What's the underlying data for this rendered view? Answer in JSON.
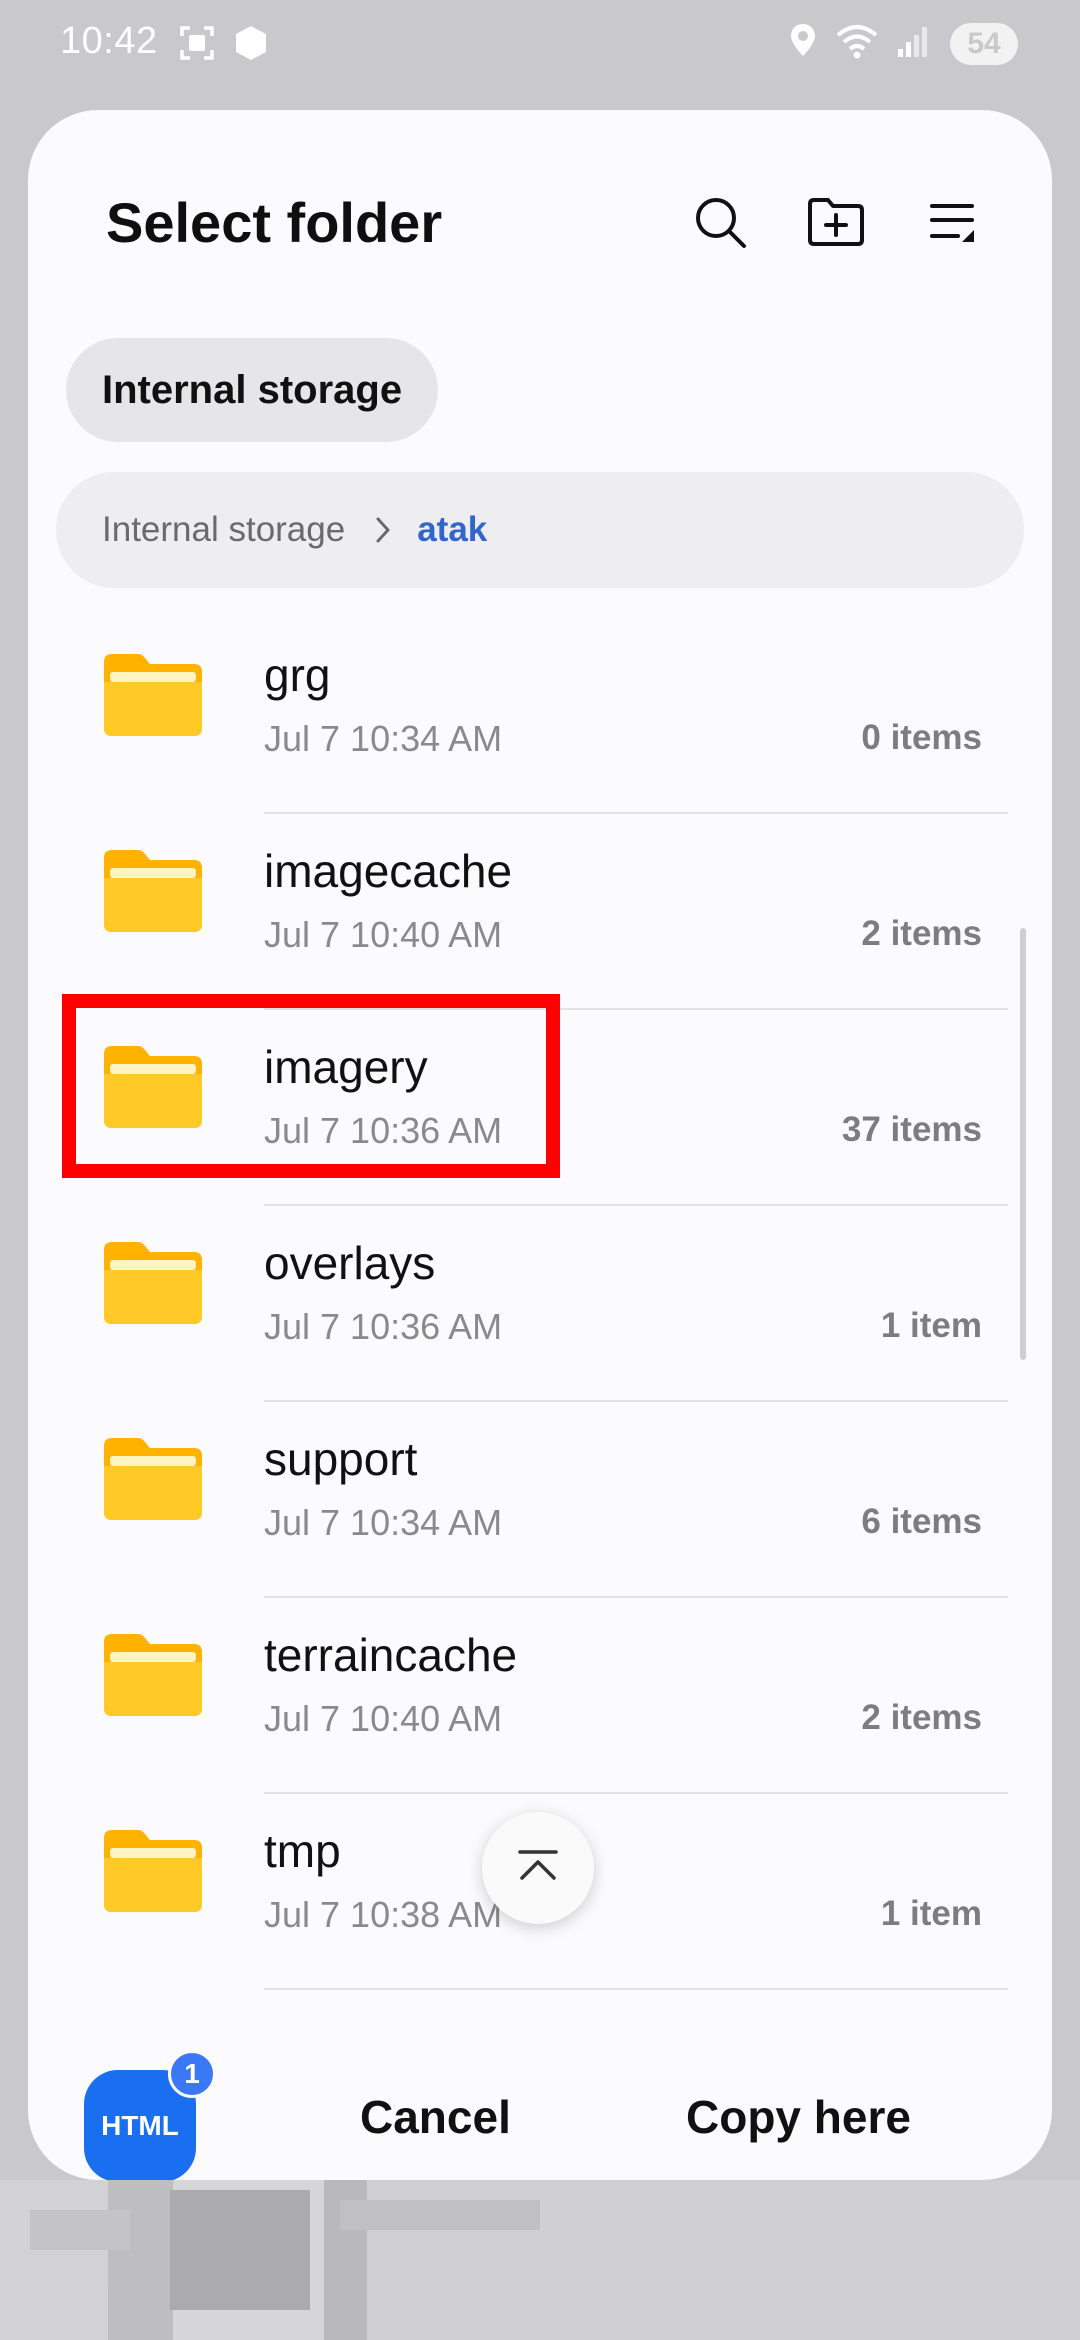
{
  "status_bar": {
    "time": "10:42",
    "battery": "54"
  },
  "header": {
    "title": "Select folder",
    "actions": [
      "search-icon",
      "new-folder-icon",
      "sort-icon"
    ]
  },
  "storage_chip": {
    "label": "Internal storage"
  },
  "breadcrumb": {
    "root": "Internal storage",
    "current": "atak"
  },
  "folders": [
    {
      "name": "grg",
      "date": "Jul 7 10:34 AM",
      "count": "0 items"
    },
    {
      "name": "imagecache",
      "date": "Jul 7 10:40 AM",
      "count": "2 items"
    },
    {
      "name": "imagery",
      "date": "Jul 7 10:36 AM",
      "count": "37 items"
    },
    {
      "name": "overlays",
      "date": "Jul 7 10:36 AM",
      "count": "1 item"
    },
    {
      "name": "support",
      "date": "Jul 7 10:34 AM",
      "count": "6 items"
    },
    {
      "name": "terraincache",
      "date": "Jul 7 10:40 AM",
      "count": "2 items"
    },
    {
      "name": "tmp",
      "date": "Jul 7 10:38 AM",
      "count": "1 item"
    }
  ],
  "bottom_bar": {
    "app_label": "HTML",
    "badge_count": "1",
    "cancel_label": "Cancel",
    "copy_label": "Copy here"
  },
  "colors": {
    "accent": "#3366cc",
    "folder": "#ffc107",
    "highlight": "#ff0000",
    "app_icon": "#1a6ef0"
  }
}
